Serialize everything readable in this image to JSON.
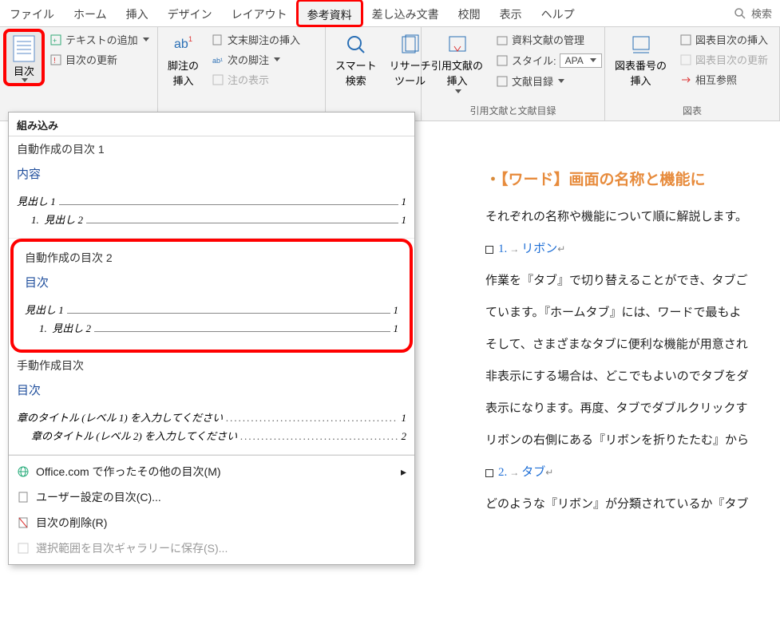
{
  "tabs": [
    "ファイル",
    "ホーム",
    "挿入",
    "デザイン",
    "レイアウト",
    "参考資料",
    "差し込み文書",
    "校閲",
    "表示",
    "ヘルプ"
  ],
  "active_tab_index": 5,
  "search_placeholder": "検索",
  "ribbon": {
    "toc": {
      "label": "目次"
    },
    "add_text": "テキストの追加",
    "update_toc": "目次の更新",
    "footnote_big": "脚注の\n挿入",
    "insert_endnote": "文末脚注の挿入",
    "next_footnote": "次の脚注",
    "show_notes": "注の表示",
    "smart_lookup": "スマート\n検索",
    "research_tool": "リサーチ\nツール",
    "insert_citation": "引用文献の\n挿入",
    "manage_sources": "資料文献の管理",
    "style_label": "スタイル:",
    "style_value": "APA",
    "bibliography": "文献目録",
    "group_citations": "引用文献と文献目録",
    "insert_figcaption": "図表番号の\n挿入",
    "insert_tof": "図表目次の挿入",
    "update_tof": "図表目次の更新",
    "cross_ref": "相互参照",
    "group_figures": "図表"
  },
  "dropdown": {
    "builtin_header": "組み込み",
    "auto1_title": "自動作成の目次 1",
    "auto1_heading": "内容",
    "h1": "見出し 1",
    "h2_prefix": "1.",
    "h2": "見出し 2",
    "pg1": "1",
    "auto2_title": "自動作成の目次 2",
    "auto2_heading": "目次",
    "manual_title": "手動作成目次",
    "manual_heading": "目次",
    "manual_l1": "章のタイトル (レベル 1) を入力してください",
    "manual_l2": "章のタイトル (レベル 2) を入力してください",
    "manual_pg1": "1",
    "manual_pg2": "2",
    "more_office": "Office.com で作ったその他の目次(M)",
    "custom_toc": "ユーザー設定の目次(C)...",
    "remove_toc": "目次の削除(R)",
    "save_gallery": "選択範囲を目次ギャラリーに保存(S)..."
  },
  "document": {
    "title": "【ワード】画面の名称と機能に",
    "intro": "それぞれの名称や機能について順に解説します。",
    "item1_num": "1.",
    "item1_label": "リボン",
    "p1": "作業を『タブ』で切り替えることができ、タブご",
    "p2": "ています。『ホームタブ』には、ワードで最もよ",
    "p3": "そして、さまざまなタブに便利な機能が用意され",
    "p4": "非表示にする場合は、どこでもよいのでタブをダ",
    "p5": "表示になります。再度、タブでダブルクリックす",
    "p6": "リボンの右側にある『リボンを折りたたむ』から",
    "item2_num": "2.",
    "item2_label": "タブ",
    "p7": "どのような『リボン』が分類されているか『タブ"
  }
}
